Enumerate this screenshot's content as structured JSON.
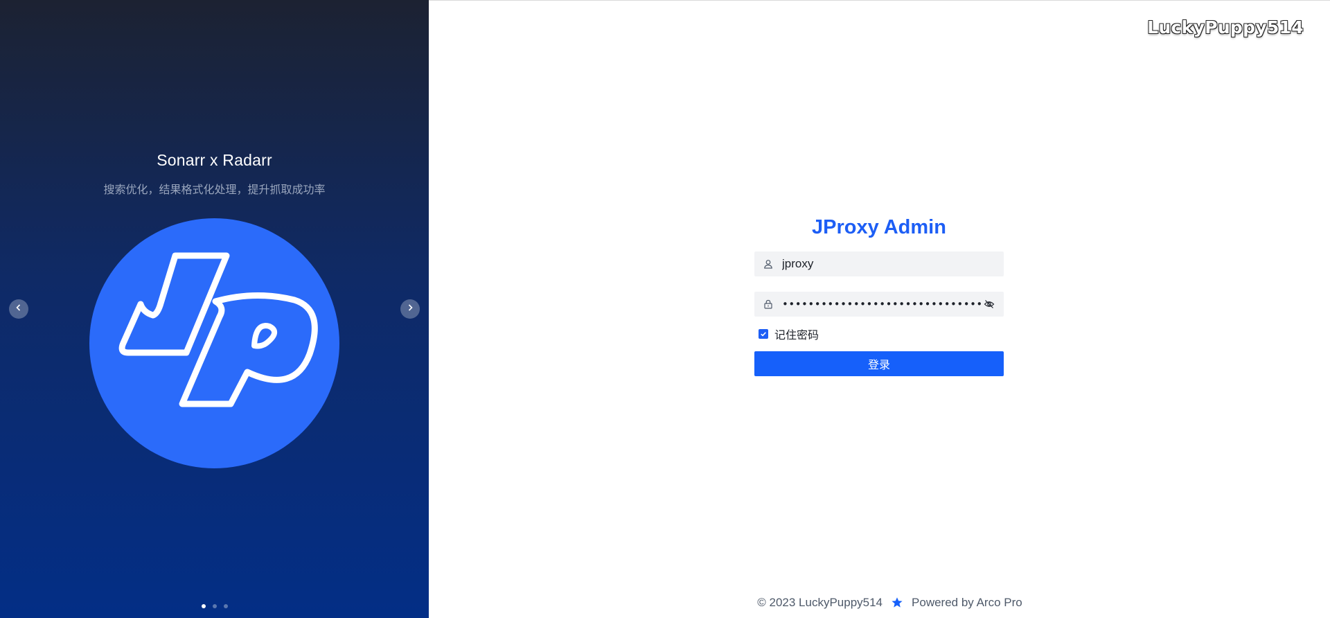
{
  "banner": {
    "title": "Sonarr x Radarr",
    "subtitle": "搜索优化，结果格式化处理，提升抓取成功率",
    "logo_icon": "jp-logo-icon",
    "prev_icon": "chevron-left-icon",
    "next_icon": "chevron-right-icon",
    "dots_total": 3,
    "dots_active": 1,
    "accent_color": "#2b6bfa"
  },
  "watermark": "LuckyPuppy514",
  "login": {
    "title": "JProxy Admin",
    "username_value": "jproxy",
    "username_icon": "user-icon",
    "password_value": "••••••••••••••••••••••••••••••••",
    "password_icon": "lock-icon",
    "visibility_icon": "eye-off-icon",
    "remember_label": "记住密码",
    "remember_checked": true,
    "submit_label": "登录",
    "primary_color": "#1660fa"
  },
  "footer": {
    "copyright": "© 2023 LuckyPuppy514",
    "powered_icon": "star-icon",
    "powered_by": "Powered by Arco Pro"
  }
}
